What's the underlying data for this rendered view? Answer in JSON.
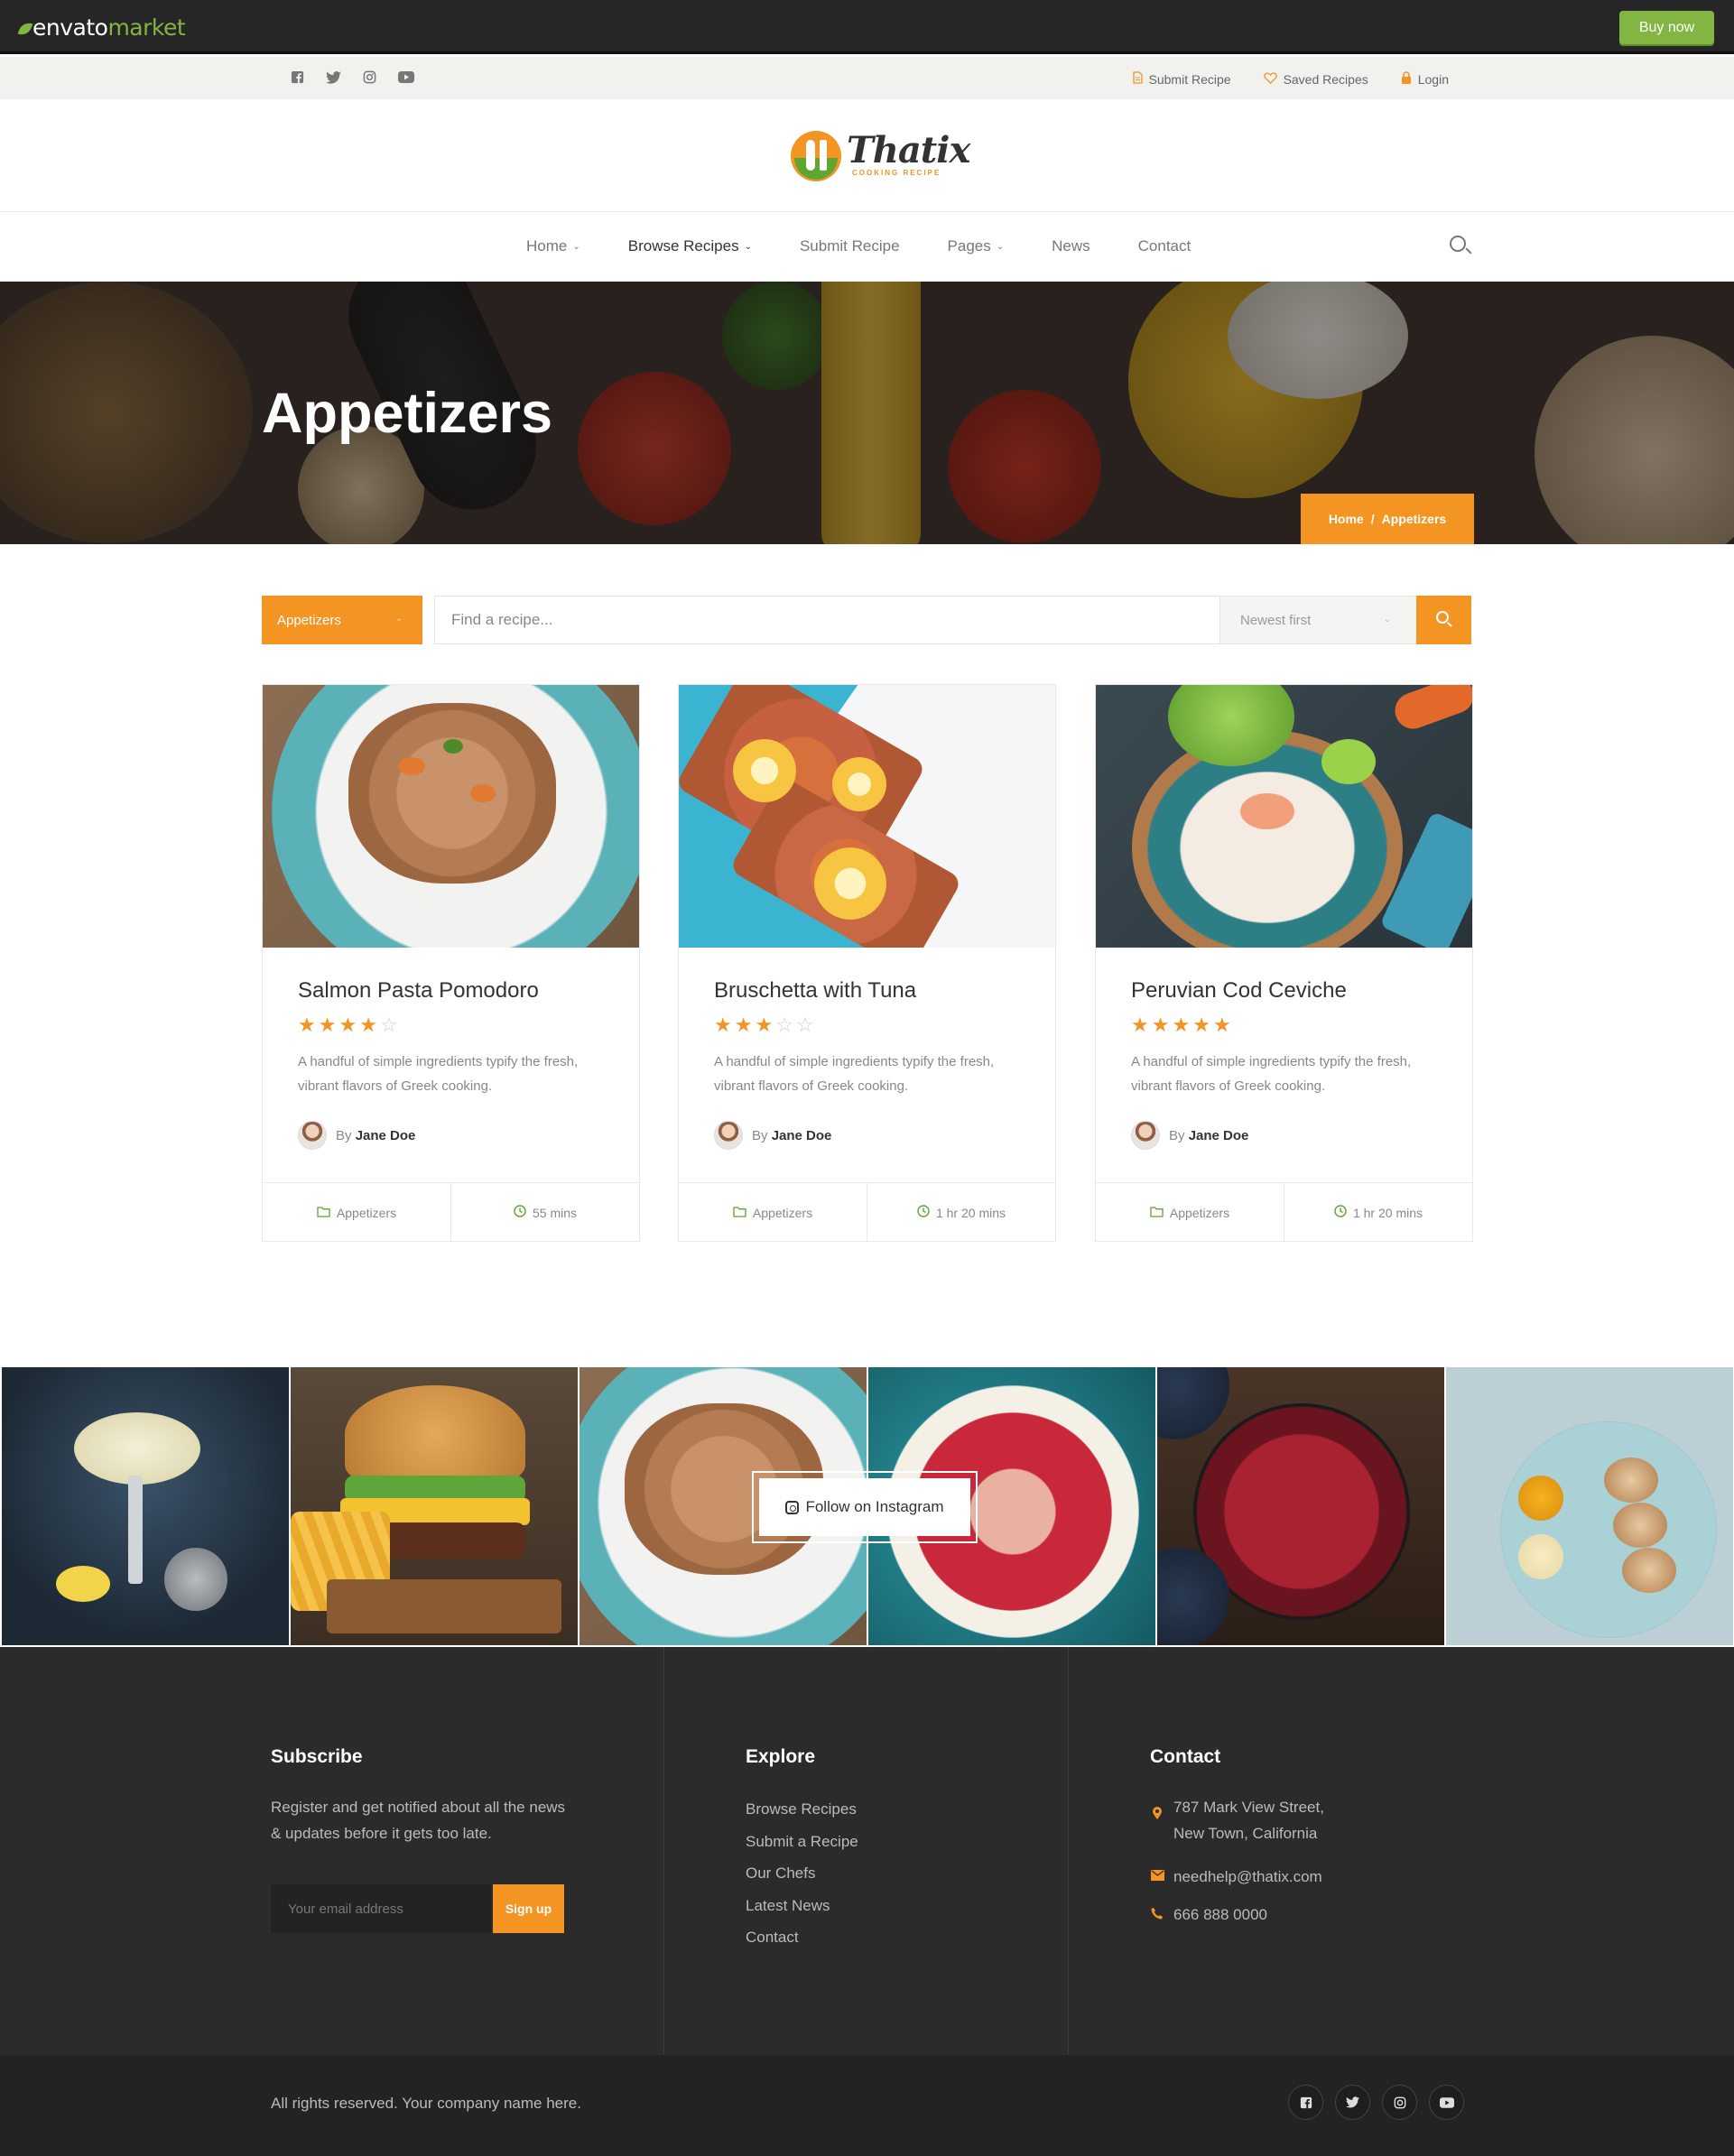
{
  "envato": {
    "logo_main": "envato",
    "logo_accent": "market",
    "buy_label": "Buy now"
  },
  "topbar": {
    "social": [
      "facebook-icon",
      "twitter-icon",
      "instagram-icon",
      "youtube-icon"
    ],
    "links": [
      {
        "label": "Submit Recipe",
        "icon": "file-icon"
      },
      {
        "label": "Saved Recipes",
        "icon": "heart-icon"
      },
      {
        "label": "Login",
        "icon": "lock-icon"
      }
    ]
  },
  "logo": {
    "name": "Thatix",
    "tagline": "COOKING RECIPE"
  },
  "nav": {
    "items": [
      {
        "label": "Home",
        "dropdown": true
      },
      {
        "label": "Browse Recipes",
        "dropdown": true,
        "active": true
      },
      {
        "label": "Submit Recipe",
        "dropdown": false
      },
      {
        "label": "Pages",
        "dropdown": true
      },
      {
        "label": "News",
        "dropdown": false
      },
      {
        "label": "Contact",
        "dropdown": false
      }
    ]
  },
  "hero": {
    "title": "Appetizers",
    "breadcrumb_home": "Home",
    "breadcrumb_sep": "/",
    "breadcrumb_current": "Appetizers"
  },
  "filters": {
    "category": "Appetizers",
    "search_placeholder": "Find a recipe...",
    "sort": "Newest first"
  },
  "recipes": [
    {
      "title": "Salmon Pasta Pomodoro",
      "rating": 4,
      "description": "A handful of simple ingredients typify the fresh, vibrant flavors of Greek cooking.",
      "by": "By",
      "author": "Jane Doe",
      "category": "Appetizers",
      "time": "55 mins"
    },
    {
      "title": "Bruschetta with Tuna",
      "rating": 3,
      "description": "A handful of simple ingredients typify the fresh, vibrant flavors of Greek cooking.",
      "by": "By",
      "author": "Jane Doe",
      "category": "Appetizers",
      "time": "1 hr 20 mins"
    },
    {
      "title": "Peruvian Cod Ceviche",
      "rating": 5,
      "description": "A handful of simple ingredients typify the fresh, vibrant flavors of Greek cooking.",
      "by": "By",
      "author": "Jane Doe",
      "category": "Appetizers",
      "time": "1 hr 20 mins"
    }
  ],
  "instagram": {
    "button_label": "Follow on Instagram"
  },
  "footer": {
    "subscribe": {
      "heading": "Subscribe",
      "text_line1": "Register and get notified about all the news",
      "text_line2": "& updates before it gets too late.",
      "email_placeholder": "Your email address",
      "button": "Sign up"
    },
    "explore": {
      "heading": "Explore",
      "links": [
        "Browse Recipes",
        "Submit a Recipe",
        "Our Chefs",
        "Latest News",
        "Contact"
      ]
    },
    "contact": {
      "heading": "Contact",
      "address_line1": "787 Mark View Street,",
      "address_line2": "New Town, California",
      "email": "needhelp@thatix.com",
      "phone": "666 888 0000"
    },
    "copyright": "All rights reserved. Your company name here."
  },
  "colors": {
    "accent": "#f39423",
    "green": "#5fa532",
    "envato_green": "#82b541",
    "footer_bg": "#2b2b2b"
  }
}
